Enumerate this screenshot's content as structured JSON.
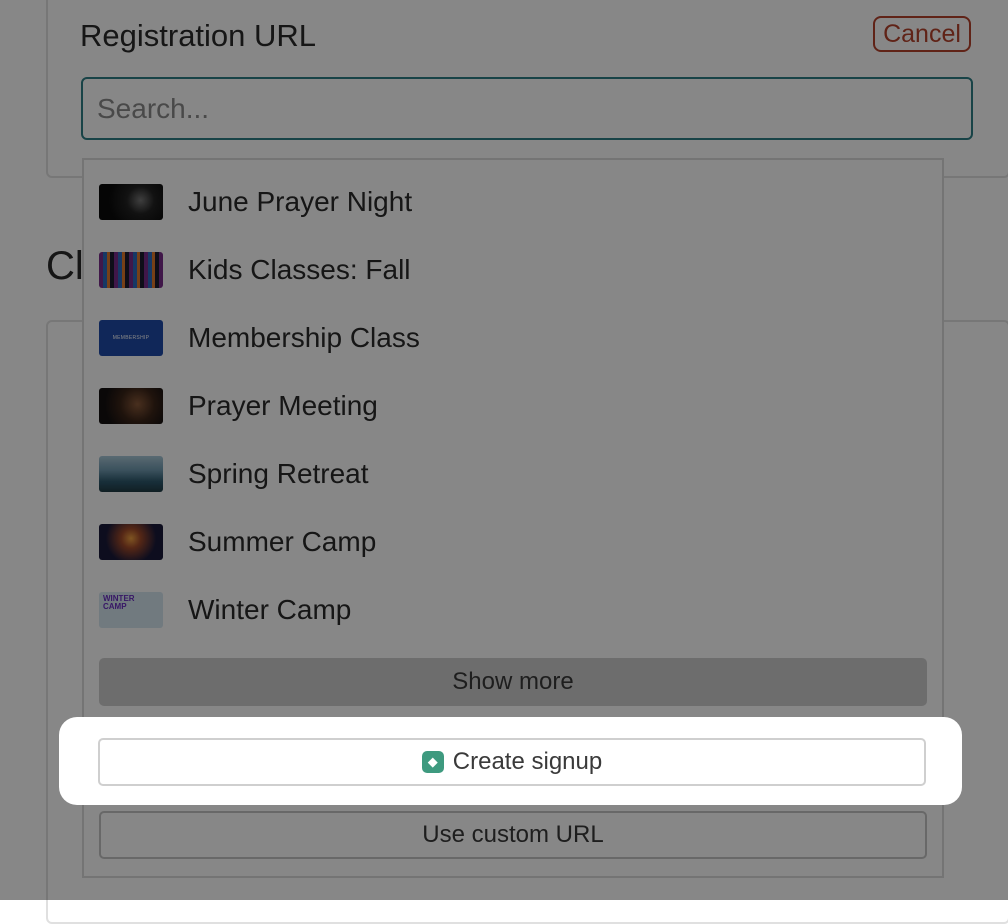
{
  "field": {
    "label": "Registration URL",
    "cancel_label": "Cancel",
    "search_placeholder": "Search..."
  },
  "background": {
    "heading_fragment": "Cl"
  },
  "dropdown": {
    "items": [
      {
        "label": "June Prayer Night",
        "thumb_icon": "prayer-night-thumbnail"
      },
      {
        "label": "Kids Classes: Fall",
        "thumb_icon": "kids-classes-thumbnail"
      },
      {
        "label": "Membership Class",
        "thumb_icon": "membership-thumbnail",
        "thumb_text": "MEMBERSHIP"
      },
      {
        "label": "Prayer Meeting",
        "thumb_icon": "prayer-meeting-thumbnail"
      },
      {
        "label": "Spring Retreat",
        "thumb_icon": "spring-retreat-thumbnail"
      },
      {
        "label": "Summer Camp",
        "thumb_icon": "summer-camp-thumbnail"
      },
      {
        "label": "Winter Camp",
        "thumb_icon": "winter-camp-thumbnail",
        "thumb_text": "WINTER CAMP"
      }
    ],
    "show_more_label": "Show more",
    "create_signup_label": "Create signup",
    "custom_url_label": "Use custom URL"
  },
  "colors": {
    "accent": "#2f7f86",
    "cancel": "#b5432d",
    "create_icon": "#3e9a7f"
  }
}
